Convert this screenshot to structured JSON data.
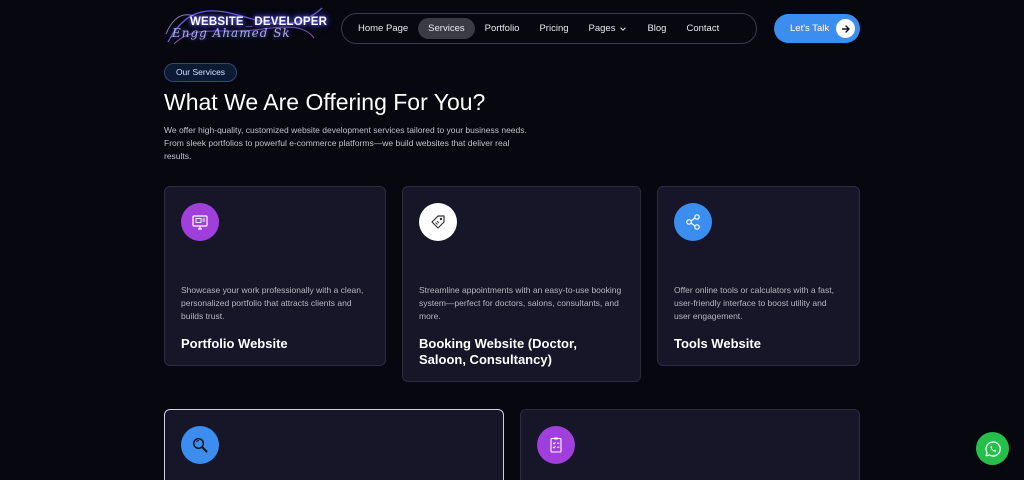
{
  "logo": {
    "main": "WEBSITE",
    "second": "DEVELOPER",
    "script": "Engg Ahamed Sk"
  },
  "nav": {
    "items": [
      {
        "label": "Home Page"
      },
      {
        "label": "Services"
      },
      {
        "label": "Portfolio"
      },
      {
        "label": "Pricing"
      },
      {
        "label": "Pages"
      },
      {
        "label": "Blog"
      },
      {
        "label": "Contact"
      }
    ],
    "active": "Services"
  },
  "cta": {
    "label": "Let's Talk"
  },
  "section": {
    "pill": "Our Services",
    "title": "What We Are Offering For You?",
    "intro": "We offer high-quality, customized website development services tailored to your business needs. From sleek portfolios to powerful e-commerce platforms—we build websites that deliver real results."
  },
  "cards": [
    {
      "icon": "monitor-icon",
      "color": "#a13fdc",
      "desc": "Showcase your work professionally with a clean, personalized portfolio that attracts clients and builds trust.",
      "title": "Portfolio Website"
    },
    {
      "icon": "tag-icon",
      "color": "#ffffff",
      "desc": "Streamline appointments with an easy-to-use booking system—perfect for doctors, salons, consultants, and more.",
      "title": "Booking Website (Doctor, Saloon, Consultancy)"
    },
    {
      "icon": "share-icon",
      "color": "#3b8ef0",
      "desc": "Offer online tools or calculators with a fast, user-friendly interface to boost utility and user engagement.",
      "title": "Tools Website"
    },
    {
      "icon": "search-icon",
      "color": "#3b8ef0"
    },
    {
      "icon": "checklist-icon",
      "color": "#a13fdc"
    }
  ],
  "floating": {
    "icon": "whatsapp-icon",
    "color": "#25c04a"
  }
}
